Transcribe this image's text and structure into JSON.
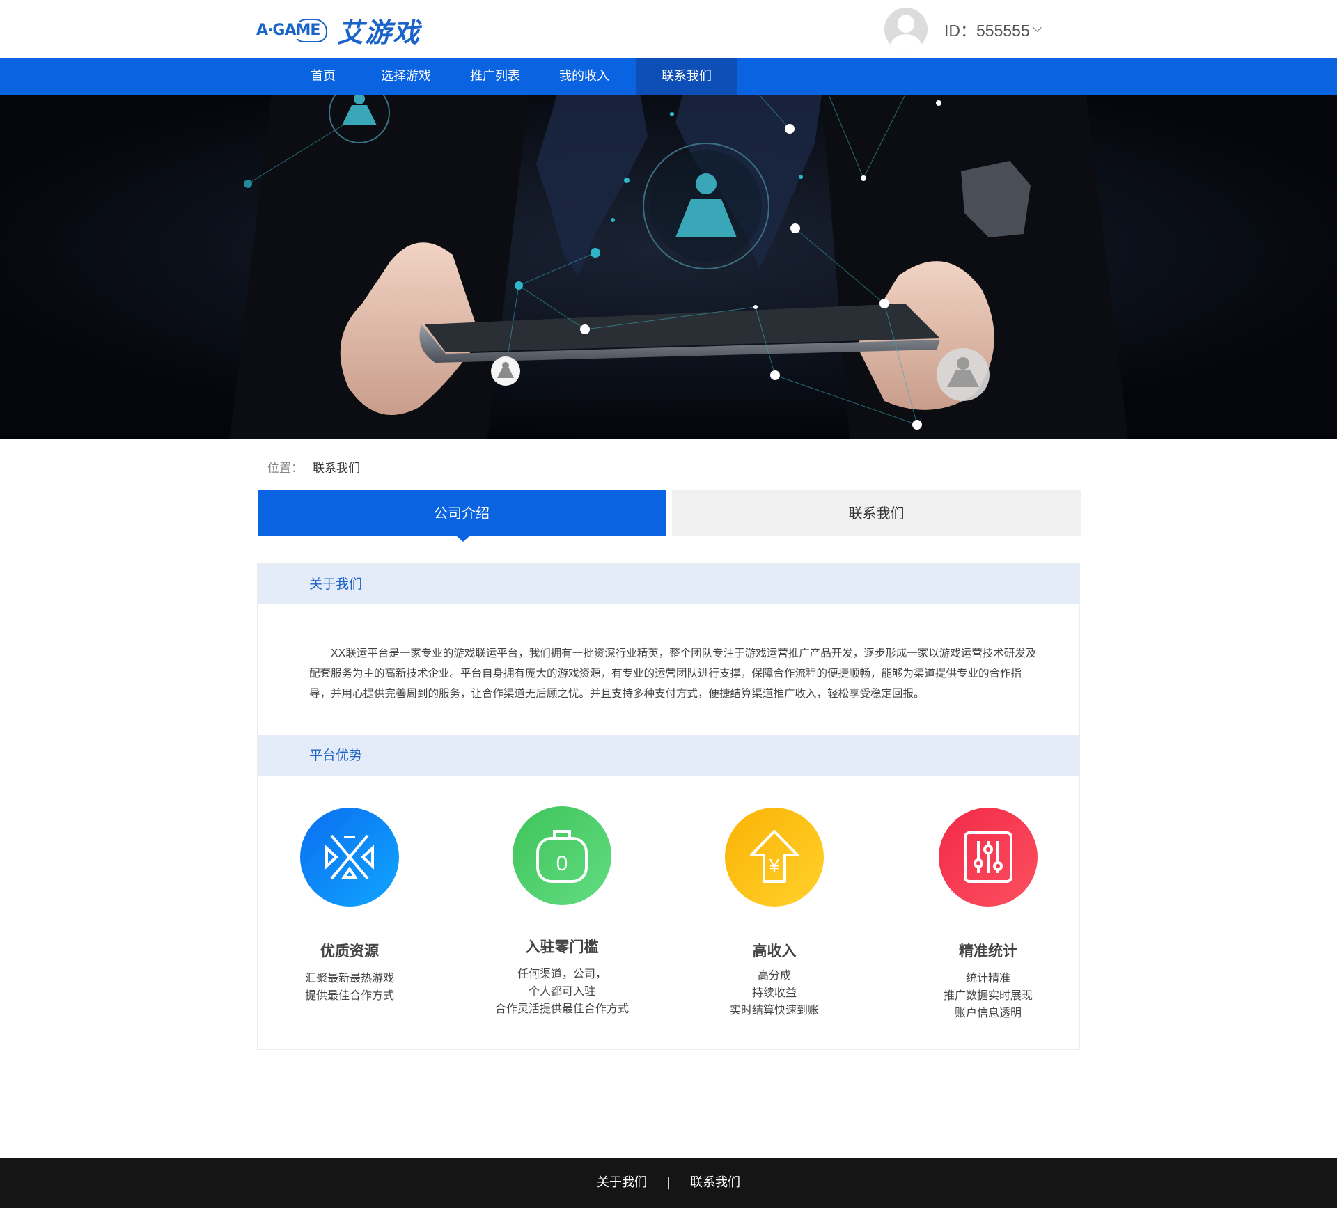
{
  "header": {
    "logo_text": "A·GAME",
    "logo_cn": "艾游戏",
    "user_id": "ID：555555"
  },
  "nav": {
    "items": [
      {
        "label": "首页"
      },
      {
        "label": "选择游戏"
      },
      {
        "label": "推广列表"
      },
      {
        "label": "我的收入"
      },
      {
        "label": "联系我们"
      }
    ],
    "active_index": 4
  },
  "breadcrumb": {
    "prefix": "位置：",
    "current": "联系我们"
  },
  "tabs": {
    "company": "公司介绍",
    "contact": "联系我们"
  },
  "about": {
    "title": "关于我们",
    "text": "XX联运平台是一家专业的游戏联运平台，我们拥有一批资深行业精英，整个团队专注于游戏运营推广产品开发，逐步形成一家以游戏运营技术研发及配套服务为主的高新技术企业。平台自身拥有庞大的游戏资源，有专业的运营团队进行支撑，保障合作流程的便捷顺畅，能够为渠道提供专业的合作指导，并用心提供完善周到的服务，让合作渠道无后顾之忧。并且支持多种支付方式，便捷结算渠道推广收入，轻松享受稳定回报。"
  },
  "advantages": {
    "title": "平台优势",
    "items": [
      {
        "icon": "resource-icon",
        "color": "#1a8cf5",
        "title": "优质资源",
        "lines": [
          "汇聚最新最热游戏",
          "提供最佳合作方式"
        ]
      },
      {
        "icon": "bag-zero-icon",
        "color": "#4cd16d",
        "title": "入驻零门槛",
        "lines": [
          "任何渠道，公司，",
          "个人都可入驻",
          "合作灵活提供最佳合作方式"
        ]
      },
      {
        "icon": "yuan-up-arrow-icon",
        "color": "#fdbf10",
        "title": "高收入",
        "lines": [
          "高分成",
          "持续收益",
          "实时结算快速到账"
        ]
      },
      {
        "icon": "sliders-icon",
        "color": "#f53a52",
        "title": "精准统计",
        "lines": [
          "统计精准",
          "推广数据实时展现",
          "账户信息透明"
        ]
      }
    ]
  },
  "footer": {
    "about": "关于我们",
    "separator": "|",
    "contact": "联系我们"
  },
  "colors": {
    "primary": "#0a63e0",
    "nav_active": "#0d4fb6",
    "section_head_bg": "#e3ecf8",
    "footer_bg": "#151515"
  }
}
